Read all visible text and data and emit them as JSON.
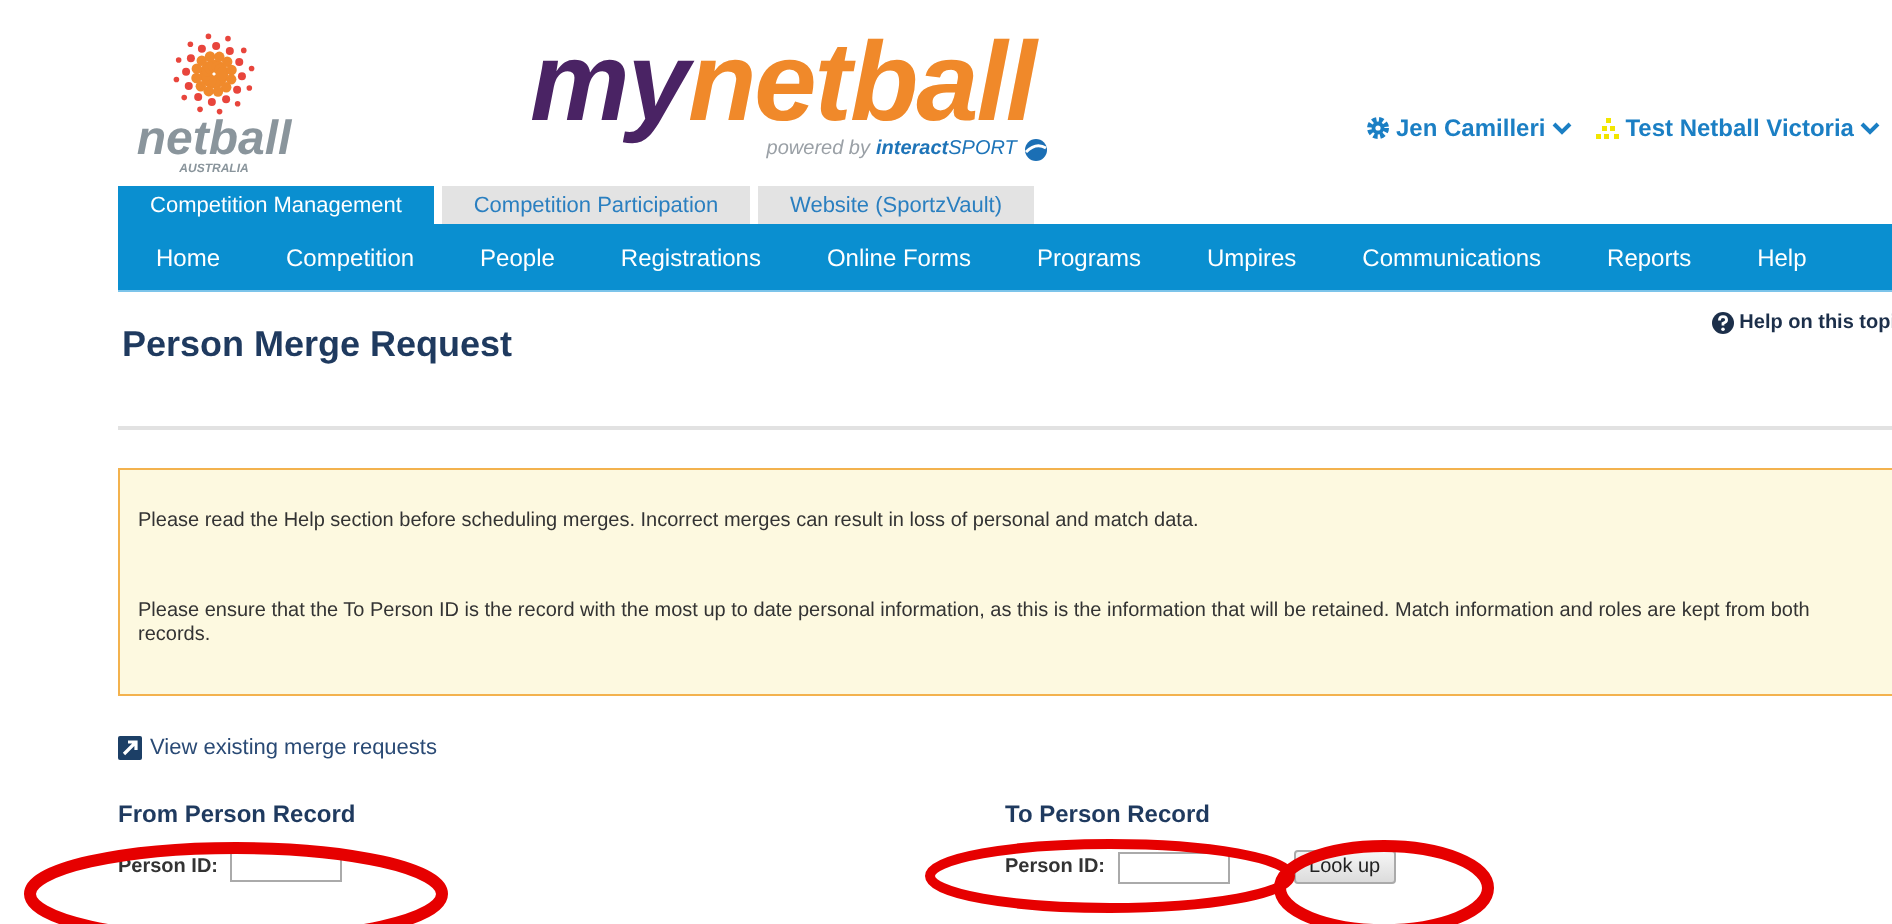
{
  "logo": {
    "brand": "netball",
    "sub": "AUSTRALIA"
  },
  "product": {
    "my": "my",
    "name": "netball",
    "powered": "powered by",
    "vendor": "interact",
    "vendor2": "SPORT"
  },
  "user_menu": [
    {
      "kind": "user",
      "label": "Jen Camilleri"
    },
    {
      "kind": "org",
      "label": "Test Netball Victoria"
    }
  ],
  "tabs": [
    {
      "label": "Competition Management",
      "selected": true
    },
    {
      "label": "Competition Participation",
      "selected": false
    },
    {
      "label": "Website (SportzVault)",
      "selected": false
    }
  ],
  "nav": [
    "Home",
    "Competition",
    "People",
    "Registrations",
    "Online Forms",
    "Programs",
    "Umpires",
    "Communications",
    "Reports",
    "Help"
  ],
  "page_title": "Person Merge Request",
  "help_link": "Help on this topi",
  "notice": [
    "Please read the Help section before scheduling merges. Incorrect merges can result in loss of personal and match data.",
    "Please ensure that the To Person ID is the record with the most up to date personal information, as this is the information that will be retained. Match information and roles are kept from both records."
  ],
  "existing_link": "View existing merge requests",
  "records": [
    {
      "heading": "From Person Record",
      "field_label": "Person ID:"
    },
    {
      "heading": "To Person Record",
      "field_label": "Person ID:",
      "button": "Look up"
    }
  ]
}
